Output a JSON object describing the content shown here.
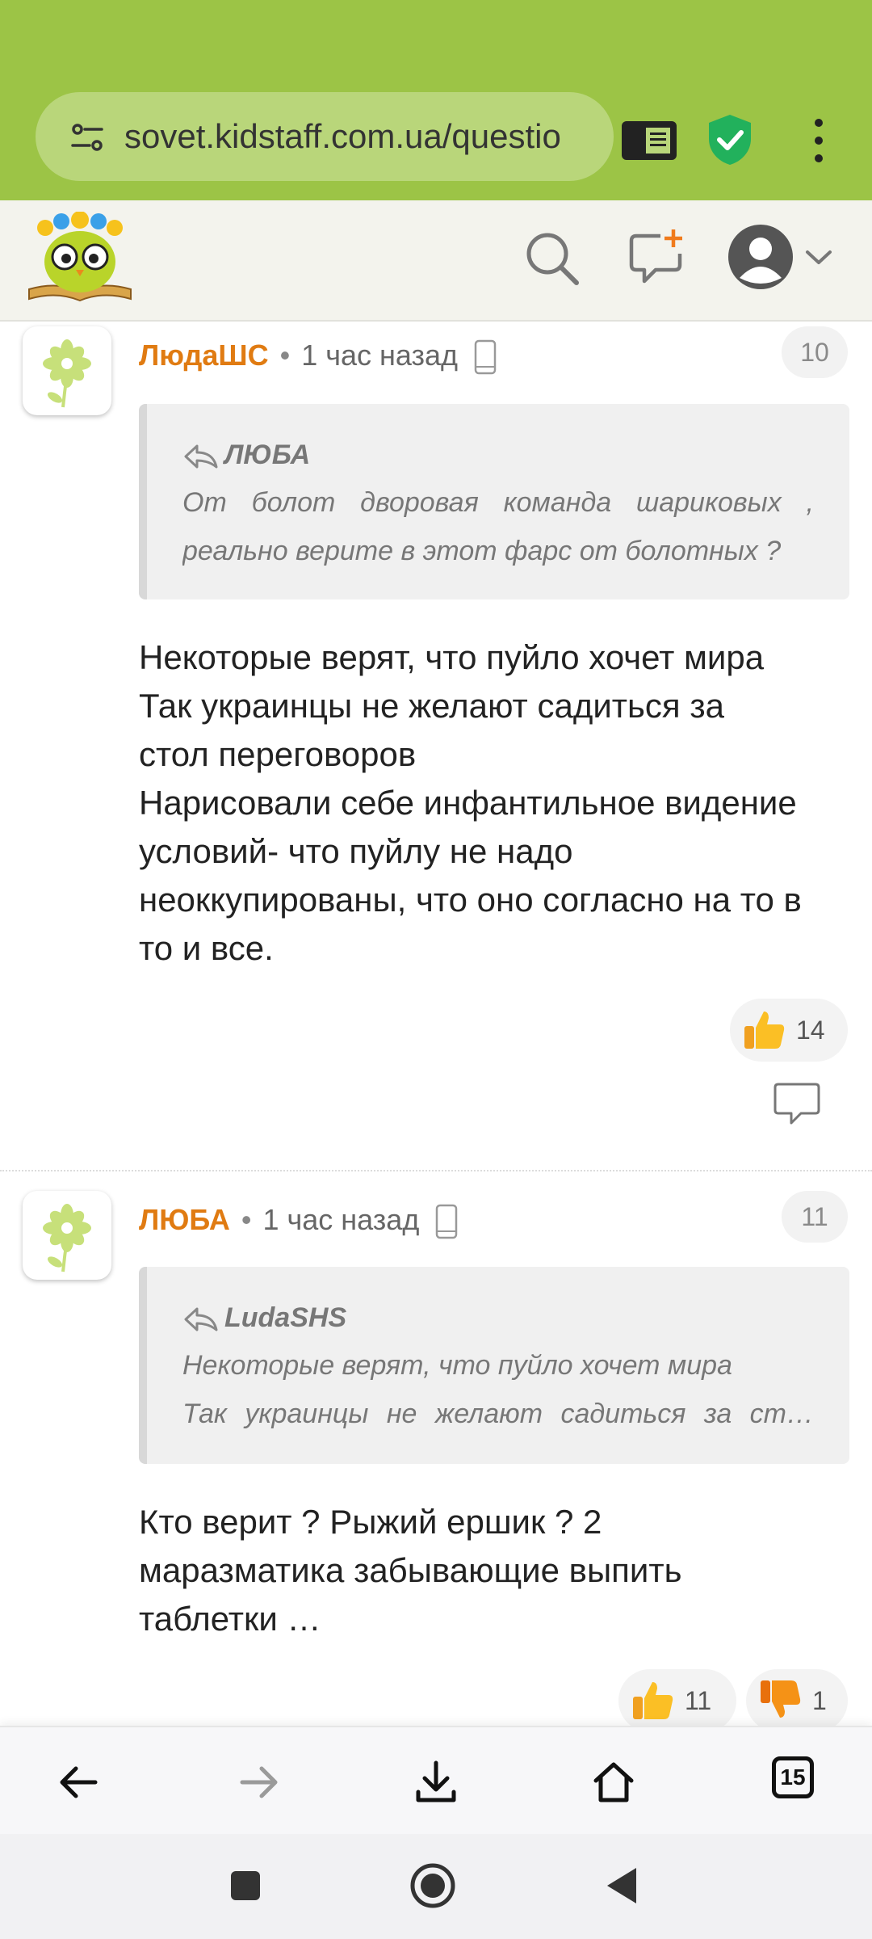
{
  "browser": {
    "url": "sovet.kidstaff.com.ua/questio",
    "accent_color": "#9cc446"
  },
  "header": {
    "logo_icon": "owl-book-logo",
    "search_icon": "search-icon",
    "new_post_icon": "new-message-icon",
    "account_icon": "account-avatar-icon"
  },
  "comments": [
    {
      "author": "ЛюдаШС",
      "separator": "•",
      "time": "1 час назад",
      "number": "10",
      "quote": {
        "author": "ЛЮБА",
        "lines": [
          "От болот дворовая команда шариковых ,",
          "реально верите в этот фарс от болотных ?"
        ]
      },
      "body": [
        "Некоторые верят, что пуйло хочет мира",
        "Так украинцы не желают садиться за",
        "стол переговоров",
        "Нарисовали себе инфантильное видение",
        "условий- что пуйлу не надо",
        "неоккупированы, что оно согласно на то в",
        "то и все."
      ],
      "likes": "14"
    },
    {
      "author": "ЛЮБА",
      "separator": "•",
      "time": "1 час назад",
      "number": "11",
      "quote": {
        "author": "LudaSHS",
        "lines": [
          "Некоторые верят, что пуйло хочет мира",
          "Так украинцы не желают садиться за ст…"
        ]
      },
      "body": [
        "Кто верит ? Рыжий ершик ? 2",
        "маразматика забывающие выпить",
        "таблетки …"
      ],
      "likes": "11",
      "dislikes": "1"
    }
  ],
  "bottom_nav": {
    "tabs_count": "15"
  }
}
